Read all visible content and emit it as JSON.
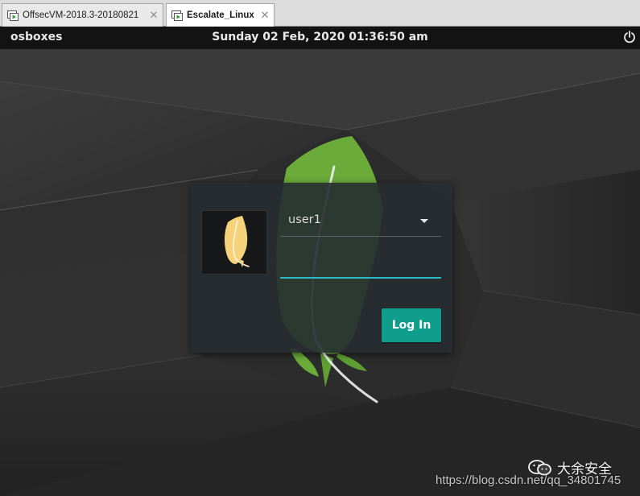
{
  "vm_tabs": [
    {
      "label": "OffsecVM-2018.3-20180821",
      "active": false,
      "close_glyph": "✕"
    },
    {
      "label": "Escalate_Linux",
      "active": true,
      "close_glyph": "✕"
    }
  ],
  "top_panel": {
    "hostname": "osboxes",
    "clock": "Sunday 02 Feb, 2020 01:36:50 am",
    "power_icon": "power-icon"
  },
  "login": {
    "avatar_icon": "feather-logo-icon",
    "user": "user1",
    "password_value": "",
    "login_label": "Log In"
  },
  "watermark": {
    "brand": "大余安全",
    "url": "https://blog.csdn.net/qq_34801745"
  },
  "colors": {
    "panel_bg": "#131313",
    "card_bg": "#262c31",
    "accent_teal": "#0f9d8c",
    "input_underline": "#2bbac6",
    "feather_green": "#6aab3a",
    "avatar_feather": "#f6d27a"
  }
}
